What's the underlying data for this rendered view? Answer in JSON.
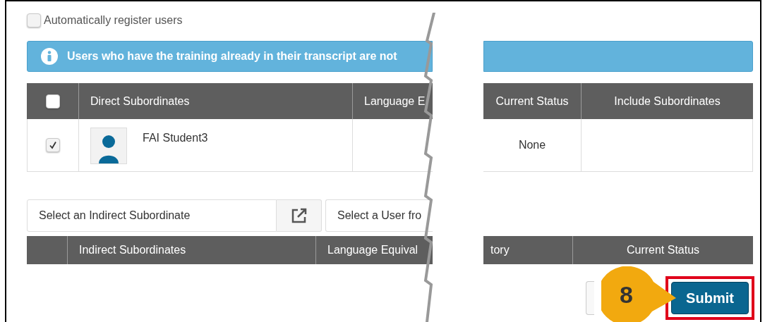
{
  "auto_register": {
    "label": "Automatically register users",
    "checked": false
  },
  "info_banner": {
    "text": "Users who have the training already in their transcript are not"
  },
  "direct_table": {
    "select_all_checked": false,
    "columns": [
      "Direct Subordinates",
      "Language E",
      "Current Status",
      "Include Subordinates"
    ],
    "rows": [
      {
        "name": "FAI Student3",
        "checked": true,
        "current_status": "None"
      }
    ]
  },
  "indirect_selector": {
    "placeholder": "Select an Indirect Subordinate"
  },
  "user_selector": {
    "placeholder": "Select a User fro"
  },
  "indirect_table": {
    "columns": [
      "Indirect Subordinates",
      "Language Equival",
      "tory",
      "Current Status"
    ]
  },
  "callout": {
    "step": "8"
  },
  "buttons": [
    {
      "kind": "secondary"
    },
    {
      "kind": "primary",
      "label": "Submit",
      "highlighted": true
    }
  ]
}
